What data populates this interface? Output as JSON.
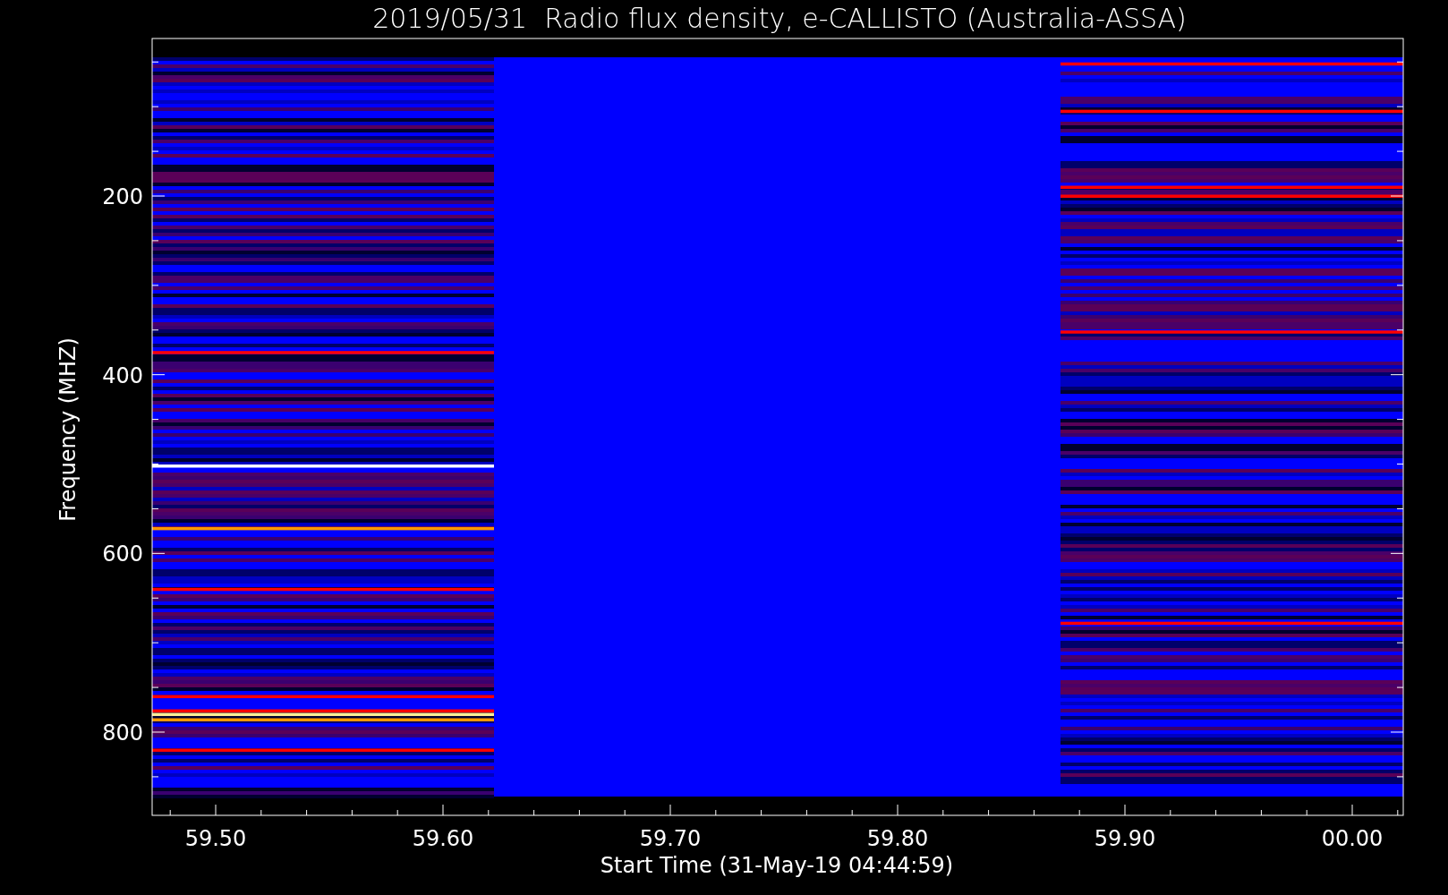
{
  "plot": {
    "title": "2019/05/31  Radio flux density, e-CALLISTO (Australia-ASSA)",
    "xlabel": "Start Time (31-May-19 04:44:59)",
    "ylabel": "Frequency (MHZ)",
    "x_tick_labels": [
      "59.50",
      "59.60",
      "59.70",
      "59.80",
      "59.90",
      "00.00"
    ],
    "y_tick_labels": [
      "200",
      "400",
      "600",
      "800"
    ]
  }
}
